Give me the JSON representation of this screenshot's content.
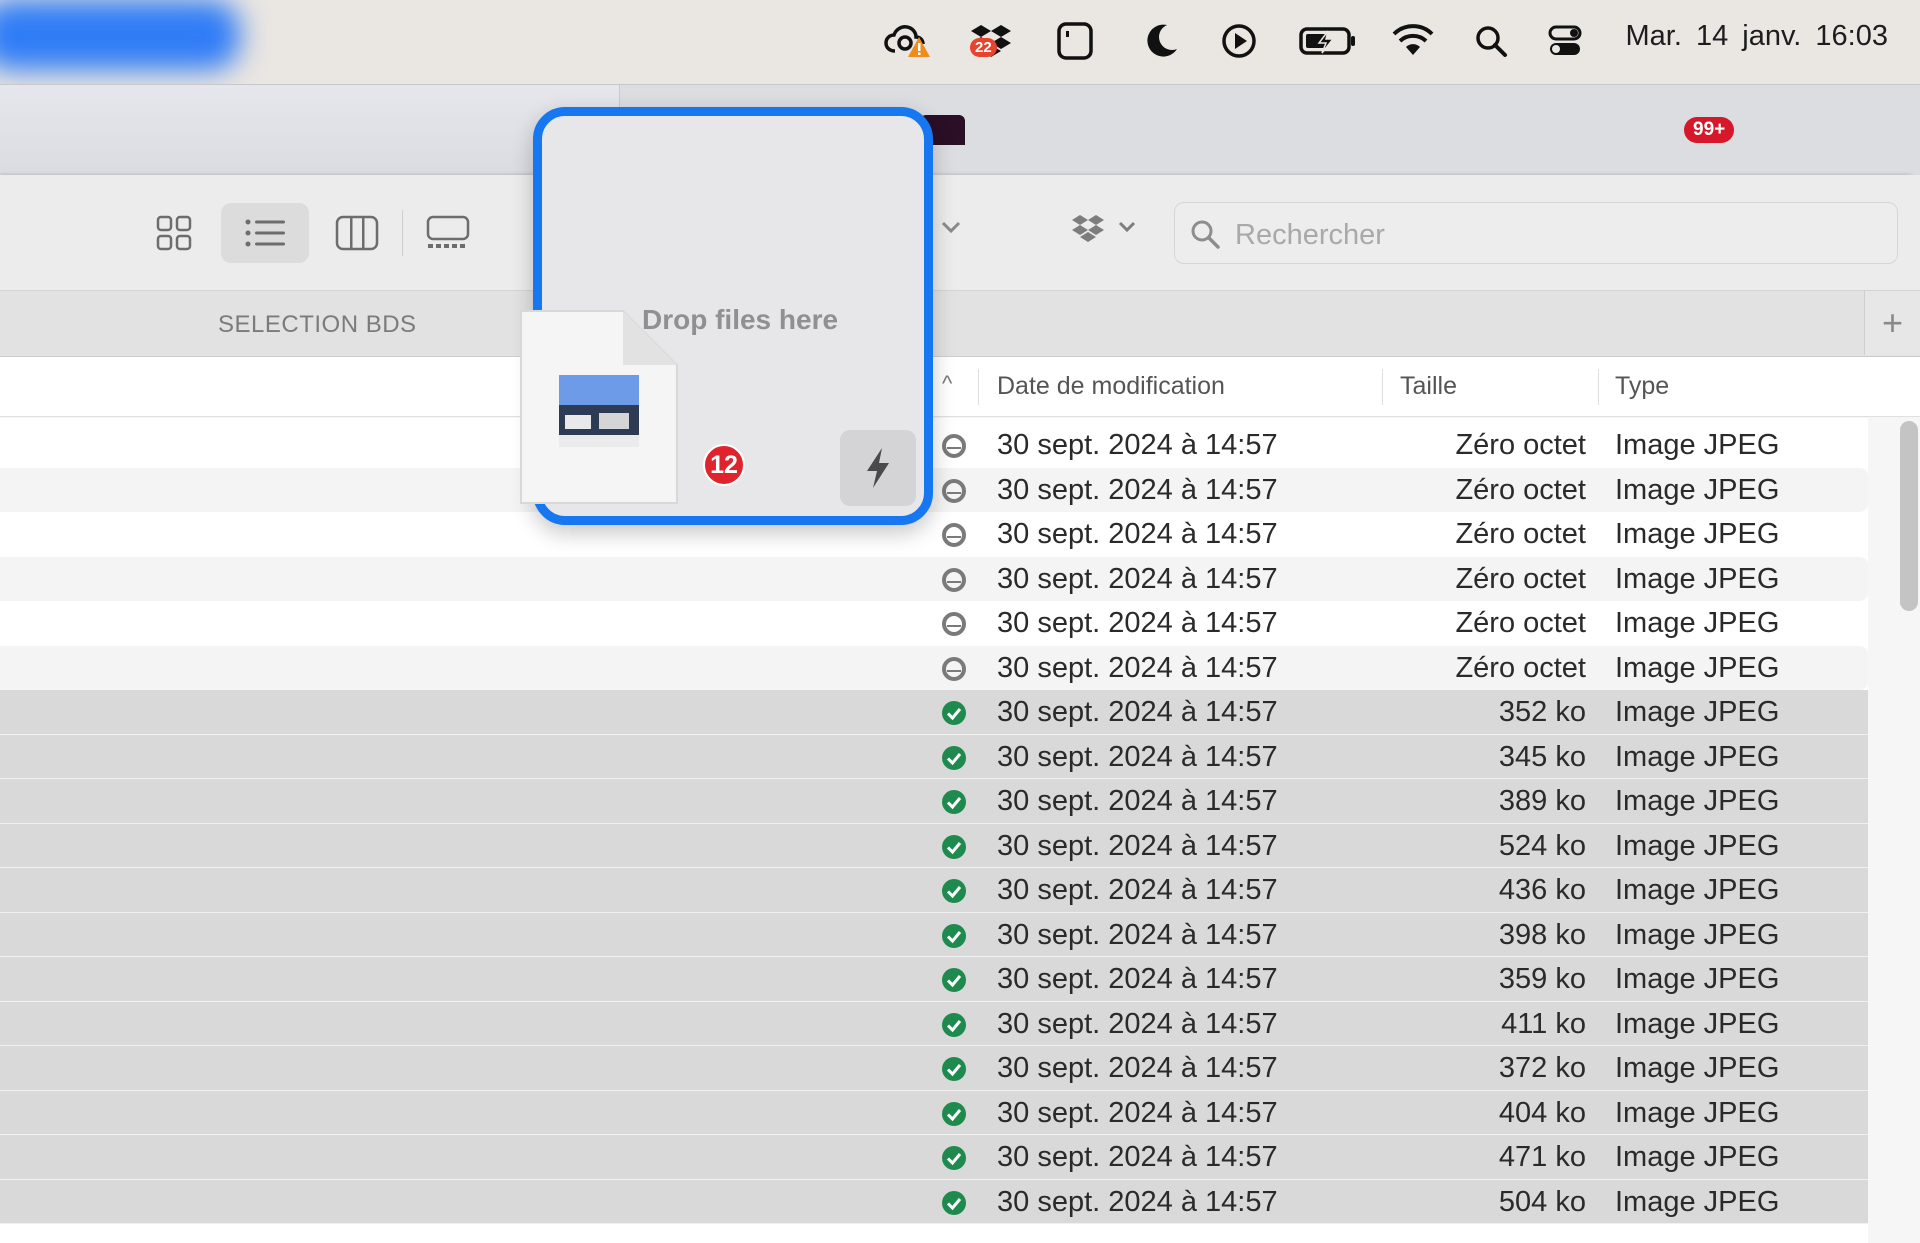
{
  "menubar": {
    "clock": "Mar. 14 janv.  16:03",
    "dropbox_badge": "22",
    "icons": [
      "creative-cloud-warning-icon",
      "dropbox-icon",
      "screen-app-icon",
      "do-not-disturb-moon-icon",
      "play-circle-icon",
      "battery-charging-icon",
      "wifi-icon",
      "search-icon",
      "control-center-icon"
    ]
  },
  "background_window": {
    "notifications_badge": "99+"
  },
  "toolbar": {
    "views": [
      "grid-view-icon",
      "list-view-icon",
      "column-view-icon",
      "gallery-view-icon"
    ],
    "active_view": "list",
    "search_placeholder": "Rechercher"
  },
  "tab": {
    "label": "SELECTION BDS",
    "add": "+"
  },
  "columns": {
    "sort_arrow": "^",
    "date": "Date de modification",
    "size": "Taille",
    "type": "Type"
  },
  "rows": [
    {
      "date": "30 sept. 2024 à 14:57",
      "size": "Zéro octet",
      "type": "Image JPEG",
      "status": "cloud",
      "selected": false
    },
    {
      "date": "30 sept. 2024 à 14:57",
      "size": "Zéro octet",
      "type": "Image JPEG",
      "status": "cloud",
      "selected": false
    },
    {
      "date": "30 sept. 2024 à 14:57",
      "size": "Zéro octet",
      "type": "Image JPEG",
      "status": "cloud",
      "selected": false
    },
    {
      "date": "30 sept. 2024 à 14:57",
      "size": "Zéro octet",
      "type": "Image JPEG",
      "status": "cloud",
      "selected": false
    },
    {
      "date": "30 sept. 2024 à 14:57",
      "size": "Zéro octet",
      "type": "Image JPEG",
      "status": "cloud",
      "selected": false
    },
    {
      "date": "30 sept. 2024 à 14:57",
      "size": "Zéro octet",
      "type": "Image JPEG",
      "status": "cloud",
      "selected": false
    },
    {
      "date": "30 sept. 2024 à 14:57",
      "size": "352 ko",
      "type": "Image JPEG",
      "status": "synced",
      "selected": true
    },
    {
      "date": "30 sept. 2024 à 14:57",
      "size": "345 ko",
      "type": "Image JPEG",
      "status": "synced",
      "selected": true
    },
    {
      "date": "30 sept. 2024 à 14:57",
      "size": "389 ko",
      "type": "Image JPEG",
      "status": "synced",
      "selected": true
    },
    {
      "date": "30 sept. 2024 à 14:57",
      "size": "524 ko",
      "type": "Image JPEG",
      "status": "synced",
      "selected": true
    },
    {
      "date": "30 sept. 2024 à 14:57",
      "size": "436 ko",
      "type": "Image JPEG",
      "status": "synced",
      "selected": true
    },
    {
      "date": "30 sept. 2024 à 14:57",
      "size": "398 ko",
      "type": "Image JPEG",
      "status": "synced",
      "selected": true
    },
    {
      "date": "30 sept. 2024 à 14:57",
      "size": "359 ko",
      "type": "Image JPEG",
      "status": "synced",
      "selected": true
    },
    {
      "date": "30 sept. 2024 à 14:57",
      "size": "411 ko",
      "type": "Image JPEG",
      "status": "synced",
      "selected": true
    },
    {
      "date": "30 sept. 2024 à 14:57",
      "size": "372 ko",
      "type": "Image JPEG",
      "status": "synced",
      "selected": true
    },
    {
      "date": "30 sept. 2024 à 14:57",
      "size": "404 ko",
      "type": "Image JPEG",
      "status": "synced",
      "selected": true
    },
    {
      "date": "30 sept. 2024 à 14:57",
      "size": "471 ko",
      "type": "Image JPEG",
      "status": "synced",
      "selected": true
    },
    {
      "date": "30 sept. 2024 à 14:57",
      "size": "504 ko",
      "type": "Image JPEG",
      "status": "synced",
      "selected": true
    }
  ],
  "dropzone": {
    "label": "Drop files here",
    "file_count": "12",
    "action_icon": "lightning-bolt-icon"
  },
  "colors": {
    "accent": "#1677f0",
    "synced_green": "#1e8a4e",
    "badge_red": "#e0242d"
  }
}
